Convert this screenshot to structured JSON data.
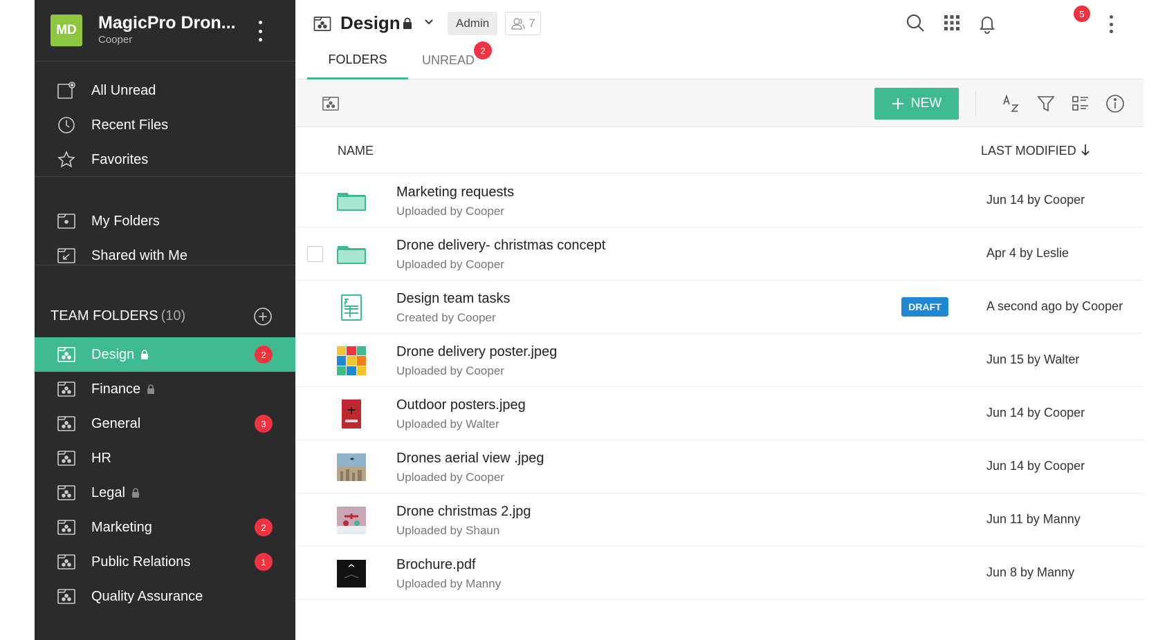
{
  "workspace": {
    "initials": "MD",
    "name": "MagicPro Dron...",
    "user": "Cooper"
  },
  "nav": {
    "primary": [
      {
        "label": "All Unread",
        "icon": "unread-icon"
      },
      {
        "label": "Recent Files",
        "icon": "clock-icon"
      },
      {
        "label": "Favorites",
        "icon": "star-icon"
      }
    ],
    "secondary": [
      {
        "label": "My Folders",
        "icon": "folder-icon"
      },
      {
        "label": "Shared with Me",
        "icon": "shared-folder-icon"
      }
    ]
  },
  "team": {
    "title": "TEAM FOLDERS",
    "count": "(10)",
    "folders": [
      {
        "label": "Design",
        "locked": true,
        "badge": "2",
        "active": true
      },
      {
        "label": "Finance",
        "locked": true,
        "badge": ""
      },
      {
        "label": "General",
        "locked": false,
        "badge": "3"
      },
      {
        "label": "HR",
        "locked": false,
        "badge": ""
      },
      {
        "label": "Legal",
        "locked": true,
        "badge": ""
      },
      {
        "label": "Marketing",
        "locked": false,
        "badge": "2"
      },
      {
        "label": "Public Relations",
        "locked": false,
        "badge": "1"
      },
      {
        "label": "Quality Assurance",
        "locked": false,
        "badge": ""
      }
    ]
  },
  "header": {
    "title": "Design",
    "role": "Admin",
    "members": "7",
    "notifications": "5"
  },
  "tabs": {
    "folders": "FOLDERS",
    "unread": "UNREAD",
    "unread_badge": "2"
  },
  "toolbar": {
    "new_label": "NEW"
  },
  "columns": {
    "name": "NAME",
    "modified": "LAST MODIFIED"
  },
  "colors": {
    "accent": "#3dbb8f",
    "sidebar": "#2b2b2b",
    "badge": "#ef3340",
    "draft": "#1e88d4",
    "avatar": "#8dc63f"
  },
  "files": [
    {
      "title": "Marketing requests",
      "sub": "Uploaded by Cooper",
      "modified": "Jun 14 by Cooper",
      "kind": "folder",
      "draft": ""
    },
    {
      "title": "Drone delivery- christmas concept",
      "sub": "Uploaded by Cooper",
      "modified": "Apr 4 by Leslie",
      "kind": "folder",
      "draft": "",
      "checkbox": true
    },
    {
      "title": "Design team tasks",
      "sub": "Created by Cooper",
      "modified": "A second ago by Cooper",
      "kind": "sheet",
      "draft": "DRAFT"
    },
    {
      "title": "Drone delivery poster.jpeg",
      "sub": "Uploaded by Cooper",
      "modified": "Jun 15 by Walter",
      "kind": "poster-grid",
      "draft": ""
    },
    {
      "title": "Outdoor posters.jpeg",
      "sub": "Uploaded by Walter",
      "modified": "Jun 14 by Cooper",
      "kind": "poster-red",
      "draft": ""
    },
    {
      "title": "Drones aerial view .jpeg",
      "sub": "Uploaded by Cooper",
      "modified": "Jun 14 by Cooper",
      "kind": "aerial",
      "draft": ""
    },
    {
      "title": "Drone christmas 2.jpg",
      "sub": "Uploaded by Shaun",
      "modified": "Jun 11 by Manny",
      "kind": "christmas",
      "draft": ""
    },
    {
      "title": "Brochure.pdf",
      "sub": "Uploaded by Manny",
      "modified": "Jun 8 by Manny",
      "kind": "brochure",
      "draft": ""
    }
  ]
}
